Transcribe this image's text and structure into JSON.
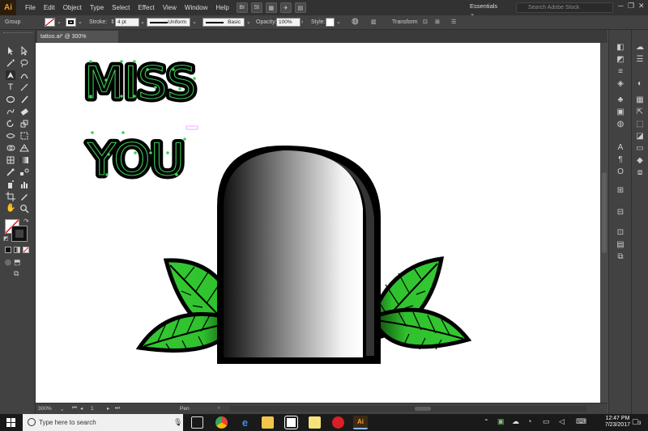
{
  "app": {
    "logo": "Ai"
  },
  "menu": [
    "File",
    "Edit",
    "Object",
    "Type",
    "Select",
    "Effect",
    "View",
    "Window",
    "Help"
  ],
  "menu_buttons": [
    "Br",
    "St"
  ],
  "workspace": "Essentials",
  "search_placeholder": "Search Adobe Stock",
  "control": {
    "selection_label": "Group",
    "stroke_label": "Stroke:",
    "stroke_value": "4 pt",
    "profile": "Uniform",
    "brush": "Basic",
    "opacity_label": "Opacity:",
    "opacity_value": "100%",
    "style_label": "Style:",
    "transform_label": "Transform"
  },
  "document_tab": "tattoo.ai* @ 300% (RGB/Preview)",
  "artwork": {
    "line1": "MISS",
    "line2": "YOU"
  },
  "status": {
    "zoom": "300%",
    "artboard": "1",
    "tool": "Pen"
  },
  "taskbar": {
    "search_placeholder": "Type here to search",
    "time": "12:47 PM",
    "date": "7/23/2017",
    "notifications": "3"
  },
  "colors": {
    "ui_dark": "#323232",
    "ui_mid": "#424242",
    "accent_ai": "#f59a2e",
    "leaf_green": "#2fc22d",
    "text_outline_green": "#22c55e"
  }
}
